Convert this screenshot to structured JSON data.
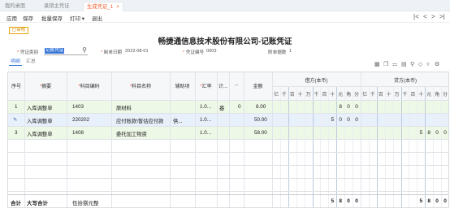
{
  "tabs": [
    "我的桌面",
    "录销主凭证",
    "生成凭证_1"
  ],
  "toolbar": {
    "items": [
      "应用",
      "保存",
      "批量保存",
      "打印 ▾",
      "退出"
    ],
    "nav": [
      "|<",
      "<",
      ">",
      ">|"
    ]
  },
  "badge": "已审核",
  "title": "畅捷通信息技术股份有限公司-记账凭证",
  "fields": {
    "voucher_type_label": "凭证类别",
    "voucher_type_value": "记账凭证",
    "date_label": "制单日期",
    "date_value": "2022-08-01",
    "number_label": "凭证编号",
    "number_value": "0003",
    "attach_label": "附单据数",
    "attach_value": "1"
  },
  "subtabs": [
    "明细",
    "汇总"
  ],
  "icons": [
    "grid-icon",
    "copy-icon",
    "split-icon",
    "table-icon",
    "filter-icon",
    "tag-icon",
    "hide-icon",
    "settings-icon"
  ],
  "columns": {
    "seq": "序号",
    "summary": "摘要",
    "code": "科目编码",
    "name": "科目名称",
    "aux": "辅助项",
    "rate": "汇率",
    "calc": "计...",
    "qty": "...",
    "amount": "金额",
    "debit": "借方(本币)",
    "credit": "贷方(本币)"
  },
  "digits": [
    "亿",
    "千",
    "百",
    "十",
    "万",
    "千",
    "百",
    "十",
    "元",
    "角",
    "分"
  ],
  "rows": [
    {
      "seq": "1",
      "summary": "入库调整单",
      "code": "1403",
      "name": "原材料",
      "aux": "",
      "rate": "1.0...",
      "calc": "盎",
      "qty": "0",
      "amount": "8.00",
      "debit": "800",
      "credit": ""
    },
    {
      "seq": "",
      "summary": "入库调整单",
      "code": "220202",
      "name": "应付账款\\暂估应付款",
      "aux": "供...",
      "rate": "1.0...",
      "calc": "",
      "qty": "",
      "amount": "50.00",
      "debit": "5000",
      "credit": ""
    },
    {
      "seq": "3",
      "summary": "入库调整单",
      "code": "1408",
      "name": "委托加工物资",
      "aux": "",
      "rate": "1.0...",
      "calc": "",
      "qty": "",
      "amount": "58.00",
      "debit": "",
      "credit": "5800"
    }
  ],
  "total": {
    "label": "合计",
    "upper_label": "大写合计",
    "upper_value": "伍拾捌元整",
    "debit": "5800",
    "credit": "5800"
  },
  "colors": {
    "accent": "#f05a28",
    "row_green": "#eef8e6",
    "row_blue": "#e8f0fb"
  }
}
